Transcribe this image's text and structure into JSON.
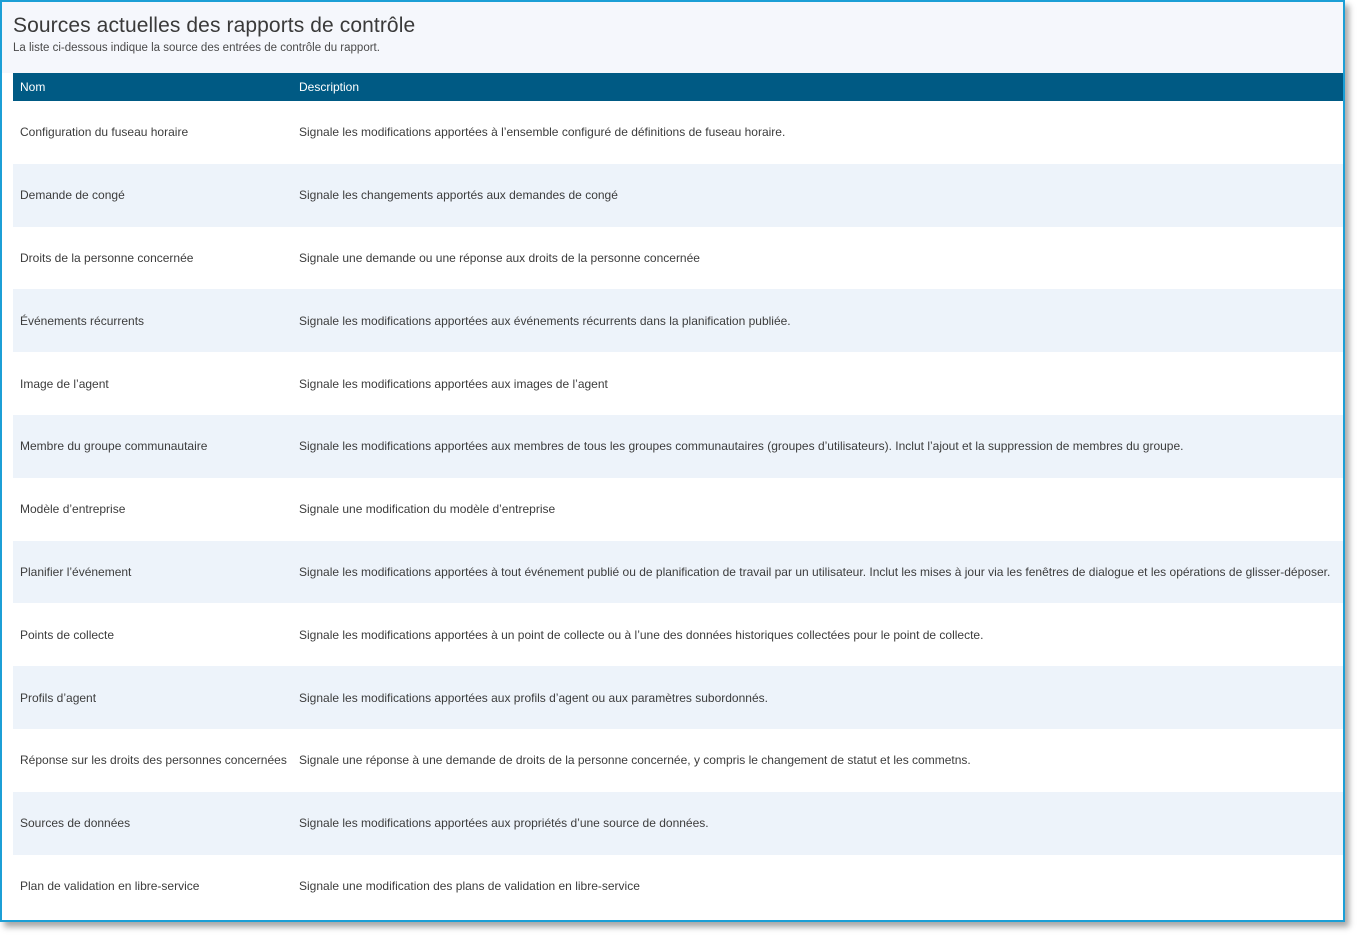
{
  "header": {
    "title": "Sources actuelles des rapports de contrôle",
    "subtitle": "La liste ci-dessous indique la source des entrées de contrôle du rapport."
  },
  "table": {
    "columns": [
      "Nom",
      "Description"
    ],
    "rows": [
      {
        "name": "Configuration du fuseau horaire",
        "description": "Signale les modifications apportées à l’ensemble configuré de définitions de fuseau horaire."
      },
      {
        "name": "Demande de congé",
        "description": "Signale les changements apportés aux demandes de congé"
      },
      {
        "name": "Droits de la personne concernée",
        "description": "Signale une demande ou une réponse aux droits de la personne concernée"
      },
      {
        "name": "Événements récurrents",
        "description": "Signale les modifications apportées aux événements récurrents dans la planification publiée."
      },
      {
        "name": "Image de l’agent",
        "description": "Signale les modifications apportées aux images de l’agent"
      },
      {
        "name": "Membre du groupe communautaire",
        "description": "Signale les modifications apportées aux membres de tous les groupes communautaires (groupes d’utilisateurs). Inclut l’ajout et la suppression de membres du groupe."
      },
      {
        "name": "Modèle d’entreprise",
        "description": "Signale une modification du modèle d’entreprise"
      },
      {
        "name": "Planifier l’événement",
        "description": "Signale les modifications apportées à tout événement publié ou de planification de travail par un utilisateur. Inclut les mises à jour via les fenêtres de dialogue et les opérations de glisser-déposer."
      },
      {
        "name": "Points de collecte",
        "description": "Signale les modifications apportées à un point de collecte ou à l’une des données historiques collectées pour le point de collecte."
      },
      {
        "name": "Profils d’agent",
        "description": "Signale les modifications apportées aux profils d’agent ou aux paramètres subordonnés."
      },
      {
        "name": "Réponse sur les droits des personnes concernées",
        "description": "Signale une réponse à une demande de droits de la personne concernée, y compris le changement de statut et les commetns."
      },
      {
        "name": "Sources de données",
        "description": "Signale les modifications apportées aux propriétés d’une source de données."
      },
      {
        "name": "Plan de validation en libre-service",
        "description": "Signale une modification des plans de validation en libre-service"
      }
    ]
  },
  "colors": {
    "header_bg": "#005a84",
    "border_accent": "#1c9fd6",
    "stripe": "#edf3fa"
  }
}
